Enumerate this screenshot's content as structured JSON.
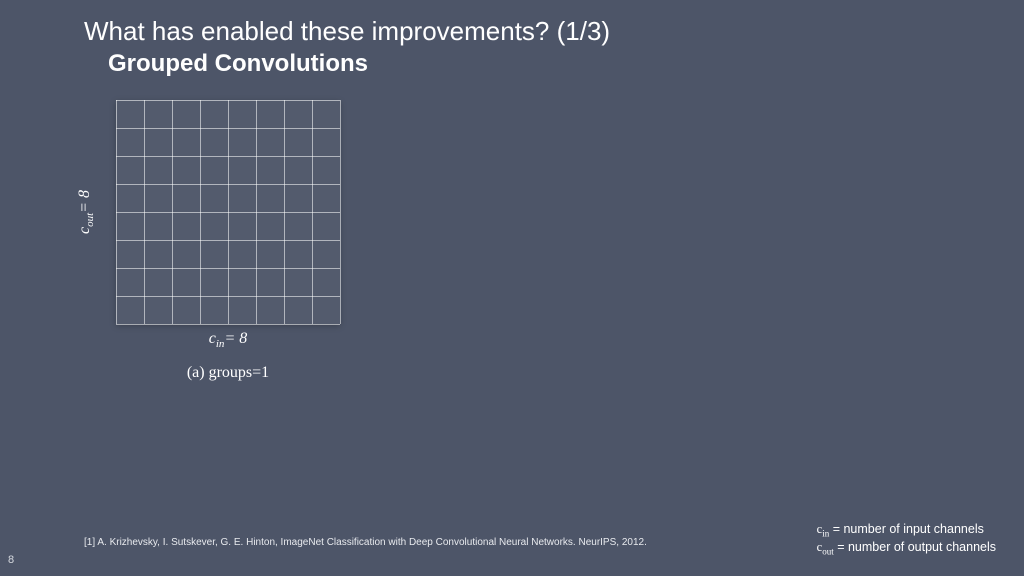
{
  "title": "What has enabled these improvements? (1/3)",
  "subtitle": "Grouped Convolutions",
  "grid": {
    "rows": 8,
    "cols": 8,
    "ylabel_var": "c",
    "ylabel_sub": "out",
    "ylabel_val": "= 8",
    "xlabel_var": "c",
    "xlabel_sub": "in",
    "xlabel_val": "= 8",
    "caption": "(a) groups=1"
  },
  "reference": "[1] A. Krizhevsky, I. Sutskever, G. E. Hinton, ImageNet Classification with Deep Convolutional Neural Networks. NeurIPS, 2012.",
  "legend": {
    "l1_var": "c",
    "l1_sub": "in",
    "l1_txt": " = number of input channels",
    "l2_var": "c",
    "l2_sub": "out",
    "l2_txt": " = number of output channels"
  },
  "page": "8"
}
